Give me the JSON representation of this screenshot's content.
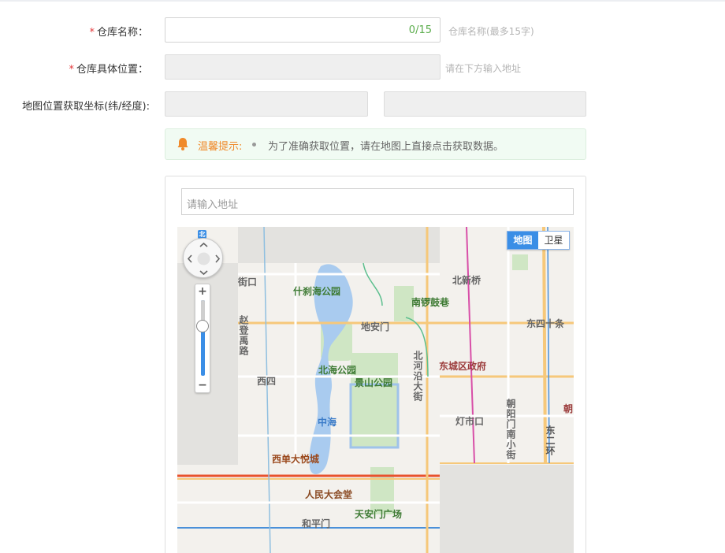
{
  "form": {
    "name": {
      "required_mark": "*",
      "label": "仓库名称：",
      "counter": "0/15",
      "hint": "仓库名称(最多15字)"
    },
    "location": {
      "required_mark": "*",
      "label": "仓库具体位置：",
      "hint": "请在下方输入地址"
    },
    "coords": {
      "label": "地图位置获取坐标(纬/经度):"
    }
  },
  "tip": {
    "icon": "bell-icon",
    "title": "温馨提示:",
    "message": "为了准确获取位置，请在地图上直接点击获取数据。"
  },
  "map": {
    "search_placeholder": "请输入地址",
    "type_buttons": [
      "地图",
      "卫星"
    ],
    "active_type": "地图",
    "zoom_in": "+",
    "zoom_out": "−",
    "logo": "北",
    "labels": {
      "l1": "什刹海公园",
      "l2": "南锣鼓巷",
      "l3": "北新桥",
      "l4": "东四十条",
      "l5": "地安门",
      "l6": "北海公园",
      "l7": "景山公园",
      "l8": "东城区政府",
      "l9": "西四",
      "l10": "中海",
      "l11": "灯市口",
      "l12": "西单大悦城",
      "l13": "人民大会堂",
      "l14": "天安门广场",
      "l15": "和平门",
      "l16": "北河沿大街",
      "l17": "朝阳门南小街",
      "l18": "东二环",
      "l19": "赵登禹路",
      "l20": "街口",
      "l21": "朝"
    }
  }
}
